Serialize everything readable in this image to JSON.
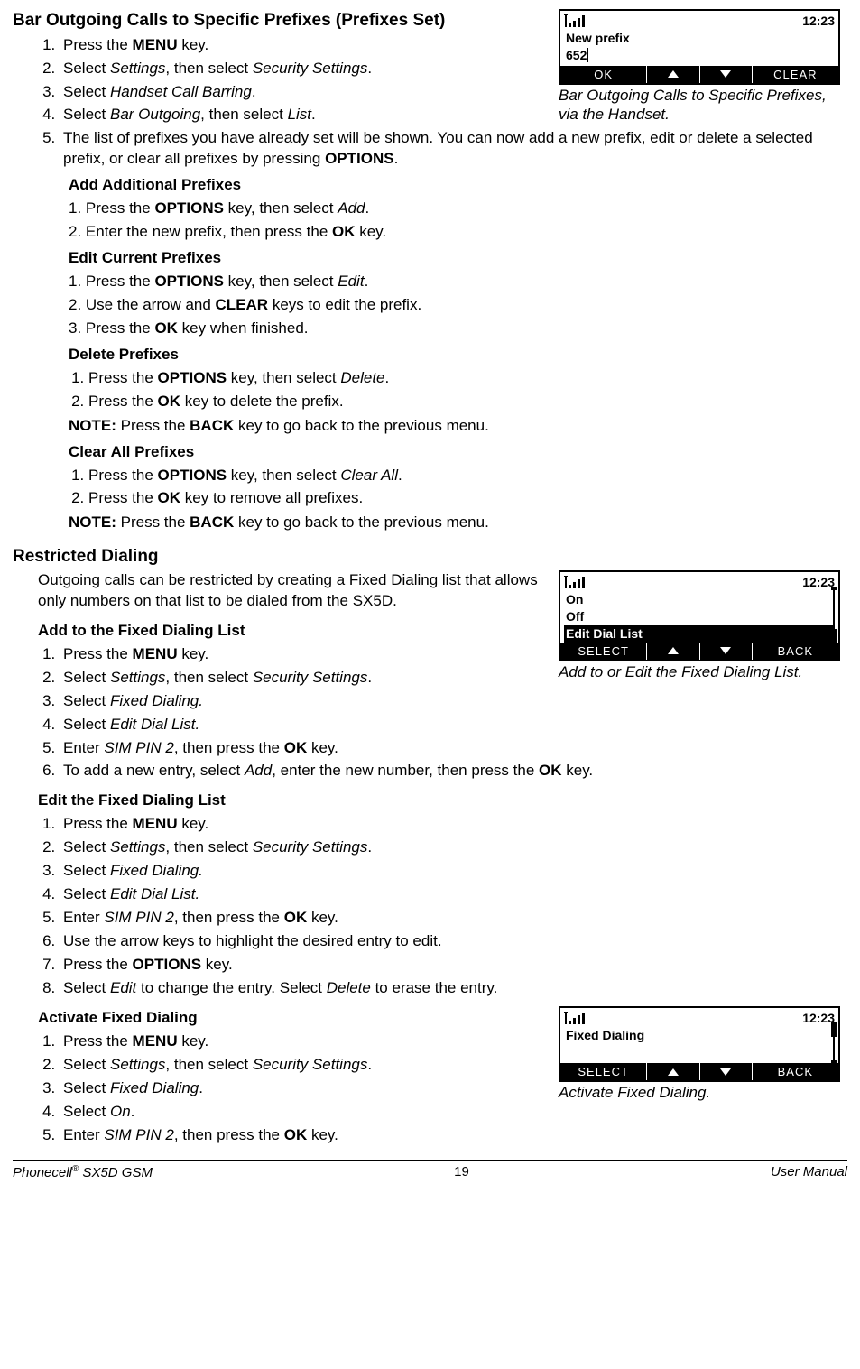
{
  "section1": {
    "title": "Bar Outgoing Calls to Specific Prefixes (Prefixes Set)",
    "steps": {
      "s1_a": "Press the ",
      "s1_b": "MENU",
      "s1_c": " key.",
      "s2_a": "Select ",
      "s2_b": "Settings",
      "s2_c": ", then select ",
      "s2_d": "Security Settings",
      "s2_e": ".",
      "s3_a": "Select ",
      "s3_b": "Handset Call Barring",
      "s3_c": ".",
      "s4_a": "Select ",
      "s4_b": "Bar Outgoing",
      "s4_c": ", then select ",
      "s4_d": "List",
      "s4_e": ".",
      "s5_a": "The list of prefixes you have already set will be shown. You can now add a new prefix, edit or delete a selected prefix, or clear all prefixes by pressing ",
      "s5_b": "OPTIONS",
      "s5_c": "."
    },
    "addPrefixes": {
      "title": "Add Additional Prefixes",
      "s1_a": "1. Press the ",
      "s1_b": "OPTIONS",
      "s1_c": " key, then select ",
      "s1_d": "Add",
      "s1_e": ".",
      "s2_a": "2. Enter the new prefix, then press the ",
      "s2_b": "OK",
      "s2_c": " key."
    },
    "editPrefixes": {
      "title": "Edit Current Prefixes",
      "s1_a": "1. Press the ",
      "s1_b": "OPTIONS",
      "s1_c": " key, then select ",
      "s1_d": "Edit",
      "s1_e": ".",
      "s2_a": "2. Use the arrow and ",
      "s2_b": "CLEAR",
      "s2_c": " keys to edit the prefix.",
      "s3_a": "3. Press the ",
      "s3_b": "OK",
      "s3_c": " key when finished."
    },
    "deletePrefixes": {
      "title": "Delete Prefixes",
      "s1_a": "Press the ",
      "s1_b": "OPTIONS",
      "s1_c": " key, then select ",
      "s1_d": "Delete",
      "s1_e": ".",
      "s2_a": "Press the ",
      "s2_b": "OK",
      "s2_c": " key to delete the prefix.",
      "note_a": "NOTE:",
      "note_b": " Press the ",
      "note_c": "BACK",
      "note_d": " key to go back to the previous menu."
    },
    "clearPrefixes": {
      "title": "Clear All Prefixes",
      "s1_a": "Press the ",
      "s1_b": "OPTIONS",
      "s1_c": " key, then select ",
      "s1_d": "Clear All",
      "s1_e": ".",
      "s2_a": "Press the ",
      "s2_b": "OK",
      "s2_c": " key to remove all prefixes.",
      "note_a": "NOTE:",
      "note_b": " Press the ",
      "note_c": "BACK",
      "note_d": " key to go back to the previous menu."
    },
    "caption": "Bar Outgoing Calls to Specific Prefixes, via the Handset."
  },
  "screen1": {
    "time": "12:23",
    "line1": "New prefix",
    "line2": "652",
    "sk_left": "OK",
    "sk_right": "CLEAR"
  },
  "section2": {
    "title": "Restricted Dialing",
    "intro": "Outgoing calls can be restricted by creating a Fixed Dialing list that allows only numbers on that list to be dialed from the SX5D.",
    "addList": {
      "title": "Add to the Fixed Dialing List",
      "s1_a": "Press the ",
      "s1_b": "MENU",
      "s1_c": " key.",
      "s2_a": "Select ",
      "s2_b": "Settings",
      "s2_c": ", then select ",
      "s2_d": "Security Settings",
      "s2_e": ".",
      "s3_a": "Select ",
      "s3_b": "Fixed Dialing.",
      "s4_a": "Select ",
      "s4_b": "Edit Dial List.",
      "s5_a": "Enter ",
      "s5_b": "SIM PIN 2",
      "s5_c": ", then press the ",
      "s5_d": "OK",
      "s5_e": " key.",
      "s6_a": "To add a new entry, select ",
      "s6_b": "Add",
      "s6_c": ", enter the new number, then press the ",
      "s6_d": "OK",
      "s6_e": " key."
    },
    "editList": {
      "title": "Edit the Fixed Dialing List",
      "s1_a": "Press the ",
      "s1_b": "MENU",
      "s1_c": " key.",
      "s2_a": "Select ",
      "s2_b": "Settings",
      "s2_c": ", then select ",
      "s2_d": "Security Settings",
      "s2_e": ".",
      "s3_a": "Select ",
      "s3_b": "Fixed Dialing.",
      "s4_a": "Select ",
      "s4_b": "Edit Dial List.",
      "s5_a": "Enter ",
      "s5_b": "SIM PIN 2",
      "s5_c": ", then press the ",
      "s5_d": "OK",
      "s5_e": " key.",
      "s6": "Use the arrow keys to highlight the desired entry to edit.",
      "s7_a": "Press the ",
      "s7_b": "OPTIONS",
      "s7_c": " key.",
      "s8_a": "Select ",
      "s8_b": "Edit",
      "s8_c": " to change the entry. Select ",
      "s8_d": "Delete",
      "s8_e": " to erase the entry."
    },
    "activate": {
      "title": "Activate Fixed Dialing",
      "s1_a": "Press the ",
      "s1_b": "MENU",
      "s1_c": " key.",
      "s2_a": "Select ",
      "s2_b": "Settings",
      "s2_c": ", then select ",
      "s2_d": "Security Settings",
      "s2_e": ".",
      "s3_a": "Select ",
      "s3_b": "Fixed Dialing",
      "s3_c": ".",
      "s4_a": "Select ",
      "s4_b": "On",
      "s4_c": ".",
      "s5_a": "Enter ",
      "s5_b": "SIM PIN 2",
      "s5_c": ", then press the ",
      "s5_d": "OK",
      "s5_e": " key."
    },
    "caption2": "Add to or Edit the Fixed Dialing List.",
    "caption3": "Activate Fixed Dialing."
  },
  "screen2": {
    "time": "12:23",
    "row1": "On",
    "row2": "Off",
    "row3": "Edit Dial List",
    "sk_left": "SELECT",
    "sk_right": "BACK"
  },
  "screen3": {
    "time": "12:23",
    "row1": "Fixed Dialing",
    "sk_left": "SELECT",
    "sk_right": "BACK"
  },
  "footer": {
    "left_a": "Phonecell",
    "left_b": " SX5D GSM",
    "center": "19",
    "right": "User Manual"
  }
}
